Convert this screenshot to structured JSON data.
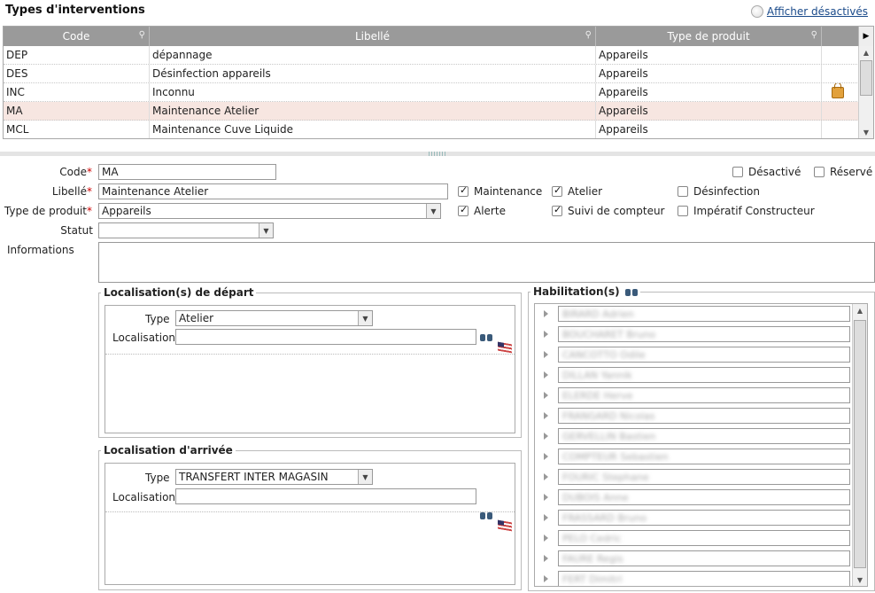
{
  "header": {
    "title": "Types d'interventions",
    "show_disabled_label": "Afficher désactivés"
  },
  "grid": {
    "columns": [
      "Code",
      "Libellé",
      "Type de produit"
    ],
    "rows": [
      {
        "code": "DEP",
        "libelle": "dépannage",
        "type": "Appareils",
        "locked": false,
        "selected": false
      },
      {
        "code": "DES",
        "libelle": "Désinfection appareils",
        "type": "Appareils",
        "locked": false,
        "selected": false
      },
      {
        "code": "INC",
        "libelle": "Inconnu",
        "type": "Appareils",
        "locked": true,
        "selected": false
      },
      {
        "code": "MA",
        "libelle": "Maintenance Atelier",
        "type": "Appareils",
        "locked": false,
        "selected": true
      },
      {
        "code": "MCL",
        "libelle": "Maintenance Cuve Liquide",
        "type": "Appareils",
        "locked": false,
        "selected": false
      }
    ]
  },
  "form": {
    "code_label": "Code",
    "code_value": "MA",
    "libelle_label": "Libellé",
    "libelle_value": "Maintenance Atelier",
    "type_label": "Type de produit",
    "type_value": "Appareils",
    "statut_label": "Statut",
    "statut_value": "",
    "info_label": "Informations",
    "desactive": {
      "label": "Désactivé",
      "checked": false
    },
    "reserve": {
      "label": "Réservé",
      "checked": false
    },
    "maintenance": {
      "label": "Maintenance",
      "checked": true
    },
    "atelier": {
      "label": "Atelier",
      "checked": true
    },
    "desinfection": {
      "label": "Désinfection",
      "checked": false
    },
    "alerte": {
      "label": "Alerte",
      "checked": true
    },
    "suivi": {
      "label": "Suivi de compteur",
      "checked": true
    },
    "imperatif": {
      "label": "Impératif Constructeur",
      "checked": false
    }
  },
  "depart": {
    "legend": "Localisation(s) de départ",
    "type_label": "Type",
    "type_value": "Atelier",
    "loc_label": "Localisation",
    "loc_value": ""
  },
  "arrivee": {
    "legend": "Localisation d'arrivée",
    "type_label": "Type",
    "type_value": "TRANSFERT INTER MAGASIN",
    "loc_label": "Localisation",
    "loc_value": ""
  },
  "habilitations": {
    "legend": "Habilitation(s)",
    "items": [
      "BIRARD Adrien",
      "BOUCHARET Bruno",
      "CANCOTTO Odile",
      "DILLAN Yannik",
      "ELERDE Herve",
      "FRANGARD Nicolas",
      "GERVELLIN Bastien",
      "COMPTEUR Sebastien",
      "FOURIC Stephane",
      "DUBOIS Anne",
      "FRASSARD Bruno",
      "PELO Cedric",
      "FAURE Regis",
      "FERT Dimitri"
    ]
  }
}
